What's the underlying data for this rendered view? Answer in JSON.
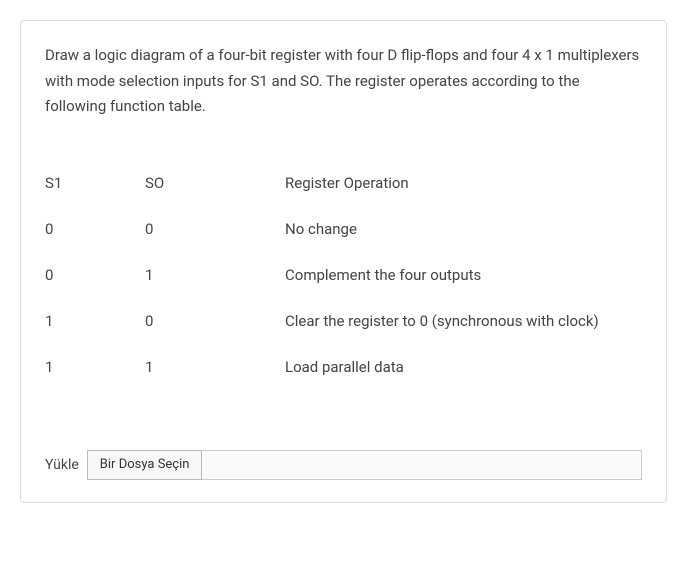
{
  "question": {
    "text": "Draw a logic diagram of a four-bit register with four D flip-flops and four 4 x 1 multiplexers with mode selection inputs for S1 and SO. The register operates according to the following function table."
  },
  "table": {
    "headers": {
      "s1": "S1",
      "s0": "SO",
      "operation": "Register Operation"
    },
    "rows": [
      {
        "s1": "0",
        "s0": "0",
        "operation": "No change"
      },
      {
        "s1": "0",
        "s0": "1",
        "operation": "Complement the four outputs"
      },
      {
        "s1": "1",
        "s0": "0",
        "operation": "Clear the register to 0 (synchronous with clock)"
      },
      {
        "s1": "1",
        "s0": "1",
        "operation": "Load parallel data"
      }
    ]
  },
  "upload": {
    "label": "Yükle",
    "button": "Bir Dosya Seçin",
    "filename": ""
  }
}
